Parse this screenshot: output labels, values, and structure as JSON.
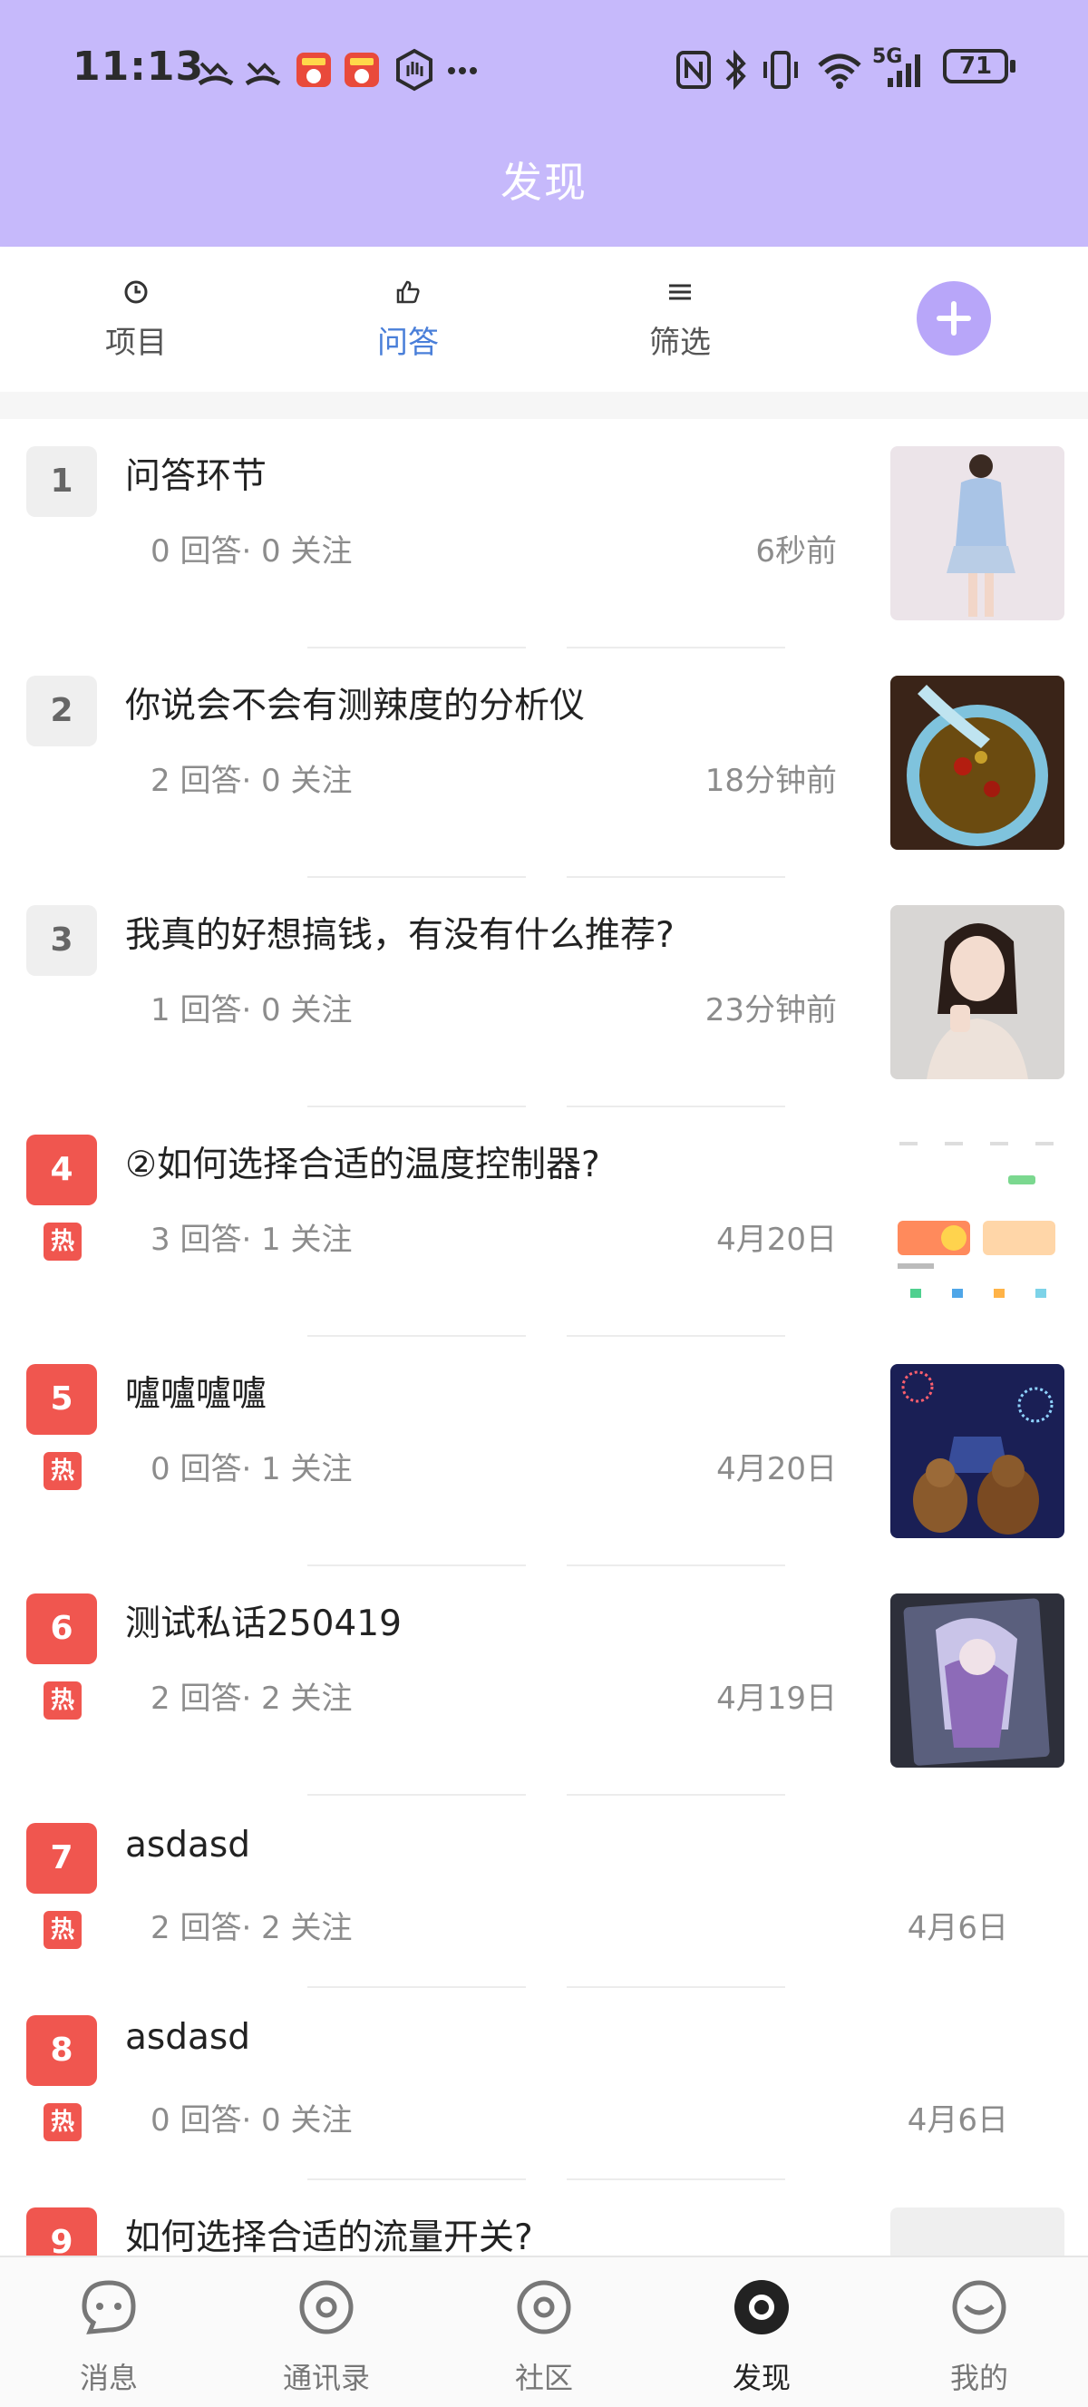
{
  "status_bar": {
    "time": "11:13",
    "battery": "71",
    "network": "5G",
    "icons": [
      "missed-call-icon",
      "missed-call-icon",
      "app-notification-icon",
      "app-notification-icon",
      "hand-icon",
      "more-dots-icon",
      "nfc-icon",
      "bluetooth-icon",
      "vibrate-icon",
      "wifi-icon",
      "signal-icon",
      "battery-icon"
    ]
  },
  "header": {
    "title": "发现"
  },
  "tabs": [
    {
      "label": "项目",
      "icon": "clock-icon"
    },
    {
      "label": "问答",
      "icon": "thumb-up-icon",
      "active": true
    },
    {
      "label": "筛选",
      "icon": "menu-lines-icon"
    }
  ],
  "accent_color": "#c6b9fb",
  "active_tab_color": "#4a7fd9",
  "hot_color": "#f0564f",
  "questions": [
    {
      "rank": "1",
      "title": "问答环节",
      "stats": "0 回答· 0 关注",
      "time": "6秒前",
      "hot": false,
      "thumb": "woman-outfit-photo"
    },
    {
      "rank": "2",
      "title": "你说会不会有测辣度的分析仪",
      "stats": "2 回答· 0 关注",
      "time": "18分钟前",
      "hot": false,
      "thumb": "hotpot-photo"
    },
    {
      "rank": "3",
      "title": "我真的好想搞钱，有没有什么推荐?",
      "stats": "1 回答· 0 关注",
      "time": "23分钟前",
      "hot": false,
      "thumb": "portrait-photo"
    },
    {
      "rank": "4",
      "title": "②如何选择合适的温度控制器?",
      "stats": "3 回答· 1 关注",
      "time": "4月20日",
      "hot": true,
      "hot_label": "热",
      "thumb": "app-screenshot"
    },
    {
      "rank": "5",
      "title": "嚧嚧嚧嚧",
      "stats": "0 回答· 1 关注",
      "time": "4月20日",
      "hot": true,
      "hot_label": "热",
      "thumb": "cartoon-bears-fireworks"
    },
    {
      "rank": "6",
      "title": "测试私话250419",
      "stats": "2 回答· 2 关注",
      "time": "4月19日",
      "hot": true,
      "hot_label": "热",
      "thumb": "anime-card"
    },
    {
      "rank": "7",
      "title": "asdasd",
      "stats": "2 回答· 2 关注",
      "time": "4月6日",
      "hot": true,
      "hot_label": "热"
    },
    {
      "rank": "8",
      "title": "asdasd",
      "stats": "0 回答· 0 关注",
      "time": "4月6日",
      "hot": true,
      "hot_label": "热"
    },
    {
      "rank": "9",
      "title": "如何选择合适的流量开关?",
      "stats": "",
      "time": "",
      "hot": true,
      "thumb": "placeholder"
    }
  ],
  "bottom_nav": [
    {
      "label": "消息",
      "icon": "chat-bubble-icon"
    },
    {
      "label": "通讯录",
      "icon": "contacts-ring-icon"
    },
    {
      "label": "社区",
      "icon": "community-ring-icon"
    },
    {
      "label": "发现",
      "icon": "discover-icon",
      "active": true
    },
    {
      "label": "我的",
      "icon": "profile-face-icon"
    }
  ]
}
